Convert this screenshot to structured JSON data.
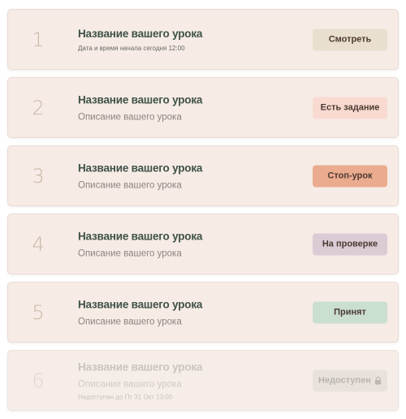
{
  "lessons": [
    {
      "number": "1",
      "title": "Название вашего урока",
      "description": "",
      "meta": "Дата и время начала сегодня 12:00",
      "button": {
        "label": "Смотреть",
        "color": "#e9dfce"
      }
    },
    {
      "number": "2",
      "title": "Название вашего урока",
      "description": "Описание вашего урока",
      "meta": "",
      "button": {
        "label": "Есть задание",
        "color": "#f8dad0"
      }
    },
    {
      "number": "3",
      "title": "Название вашего урока",
      "description": "Описание вашего урока",
      "meta": "",
      "button": {
        "label": "Стоп-урок",
        "color": "#ebab8e"
      }
    },
    {
      "number": "4",
      "title": "Название вашего урока",
      "description": "Описание вашего урока",
      "meta": "",
      "button": {
        "label": "На проверке",
        "color": "#dbcbd4"
      }
    },
    {
      "number": "5",
      "title": "Название вашего урока",
      "description": "Описание вашего урока",
      "meta": "",
      "button": {
        "label": "Принят",
        "color": "#cbdfd1"
      }
    },
    {
      "number": "6",
      "title": "Название вашего урока",
      "description": "Описание вашего урока",
      "meta": "Недоступен до Пт 31 Окт 13:00",
      "button": {
        "label": "Недоступен",
        "color": "#e8e1dc",
        "icon": "lock-icon"
      }
    }
  ]
}
